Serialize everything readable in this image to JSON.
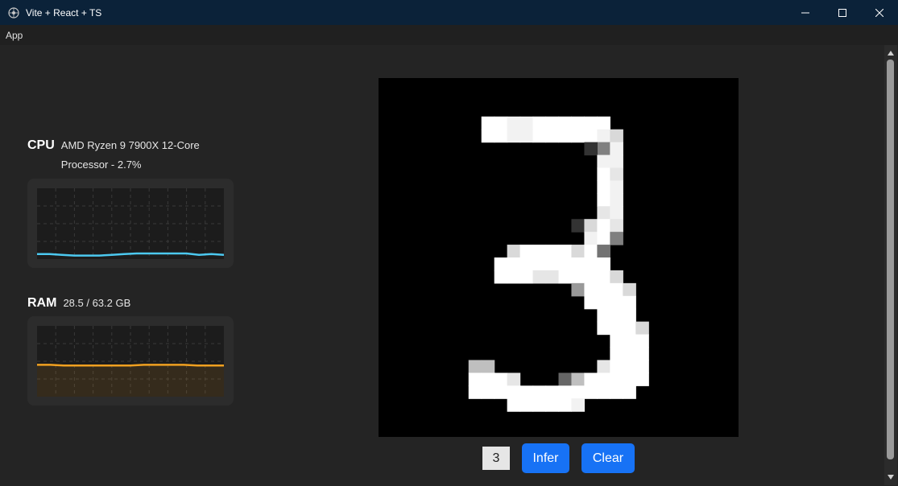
{
  "window": {
    "title": "Vite + React + TS"
  },
  "menu": {
    "items": [
      "App"
    ]
  },
  "cpu": {
    "label": "CPU",
    "name": "AMD Ryzen 9 7900X 12-Core Processor",
    "usage_percent": 2.7,
    "detail": "AMD Ryzen 9 7900X 12-Core Processor - 2.7%",
    "history_percent": [
      7,
      7,
      6,
      5,
      5,
      5,
      6,
      7,
      8,
      8,
      8,
      8,
      8,
      6,
      7,
      6
    ],
    "color": "#4cc9f0"
  },
  "ram": {
    "label": "RAM",
    "used_gb": 28.5,
    "total_gb": 63.2,
    "detail": "28.5 / 63.2 GB",
    "history_percent": [
      45,
      45,
      44,
      44,
      44,
      44,
      44,
      44,
      45,
      45,
      45,
      45,
      44,
      44,
      44
    ],
    "color": "#f0a020"
  },
  "digit": {
    "grid_size": 28,
    "strokes": [
      [
        8,
        3,
        1.0
      ],
      [
        9,
        3,
        1.0
      ],
      [
        10,
        3,
        0.95
      ],
      [
        11,
        3,
        0.95
      ],
      [
        12,
        3,
        1.0
      ],
      [
        13,
        3,
        1.0
      ],
      [
        14,
        3,
        1.0
      ],
      [
        15,
        3,
        1.0
      ],
      [
        16,
        3,
        1.0
      ],
      [
        17,
        3,
        1.0
      ],
      [
        8,
        4,
        1.0
      ],
      [
        9,
        4,
        1.0
      ],
      [
        10,
        4,
        0.95
      ],
      [
        11,
        4,
        0.95
      ],
      [
        12,
        4,
        1.0
      ],
      [
        13,
        4,
        1.0
      ],
      [
        14,
        4,
        1.0
      ],
      [
        15,
        4,
        1.0
      ],
      [
        16,
        4,
        1.0
      ],
      [
        17,
        4,
        0.95
      ],
      [
        18,
        4,
        0.85
      ],
      [
        17,
        5,
        0.5
      ],
      [
        18,
        5,
        0.95
      ],
      [
        16,
        5,
        0.2
      ],
      [
        17,
        6,
        0.95
      ],
      [
        18,
        6,
        0.95
      ],
      [
        17,
        7,
        1.0
      ],
      [
        18,
        7,
        0.9
      ],
      [
        17,
        8,
        1.0
      ],
      [
        18,
        8,
        0.95
      ],
      [
        17,
        9,
        1.0
      ],
      [
        18,
        9,
        0.95
      ],
      [
        17,
        10,
        0.9
      ],
      [
        18,
        10,
        0.95
      ],
      [
        15,
        11,
        0.2
      ],
      [
        16,
        11,
        0.85
      ],
      [
        17,
        11,
        1.0
      ],
      [
        18,
        11,
        0.9
      ],
      [
        16,
        12,
        0.95
      ],
      [
        17,
        12,
        1.0
      ],
      [
        18,
        12,
        0.5
      ],
      [
        10,
        13,
        0.85
      ],
      [
        11,
        13,
        1.0
      ],
      [
        12,
        13,
        1.0
      ],
      [
        13,
        13,
        1.0
      ],
      [
        14,
        13,
        1.0
      ],
      [
        15,
        13,
        0.85
      ],
      [
        16,
        13,
        1.0
      ],
      [
        17,
        13,
        0.45
      ],
      [
        9,
        14,
        1.0
      ],
      [
        10,
        14,
        1.0
      ],
      [
        11,
        14,
        1.0
      ],
      [
        12,
        14,
        1.0
      ],
      [
        13,
        14,
        1.0
      ],
      [
        14,
        14,
        1.0
      ],
      [
        15,
        14,
        1.0
      ],
      [
        16,
        14,
        1.0
      ],
      [
        17,
        14,
        1.0
      ],
      [
        9,
        15,
        1.0
      ],
      [
        10,
        15,
        1.0
      ],
      [
        11,
        15,
        1.0
      ],
      [
        12,
        15,
        0.9
      ],
      [
        13,
        15,
        0.9
      ],
      [
        14,
        15,
        1.0
      ],
      [
        15,
        15,
        1.0
      ],
      [
        16,
        15,
        1.0
      ],
      [
        17,
        15,
        1.0
      ],
      [
        18,
        15,
        0.85
      ],
      [
        15,
        16,
        0.6
      ],
      [
        16,
        16,
        1.0
      ],
      [
        17,
        16,
        1.0
      ],
      [
        18,
        16,
        1.0
      ],
      [
        19,
        16,
        0.85
      ],
      [
        16,
        17,
        1.0
      ],
      [
        17,
        17,
        1.0
      ],
      [
        18,
        17,
        1.0
      ],
      [
        19,
        17,
        1.0
      ],
      [
        17,
        18,
        1.0
      ],
      [
        18,
        18,
        1.0
      ],
      [
        19,
        18,
        1.0
      ],
      [
        17,
        19,
        1.0
      ],
      [
        18,
        19,
        1.0
      ],
      [
        19,
        19,
        1.0
      ],
      [
        20,
        19,
        0.85
      ],
      [
        18,
        20,
        1.0
      ],
      [
        19,
        20,
        1.0
      ],
      [
        20,
        20,
        1.0
      ],
      [
        18,
        21,
        1.0
      ],
      [
        19,
        21,
        1.0
      ],
      [
        20,
        21,
        1.0
      ],
      [
        7,
        22,
        0.75
      ],
      [
        8,
        22,
        0.75
      ],
      [
        17,
        22,
        0.9
      ],
      [
        18,
        22,
        1.0
      ],
      [
        19,
        22,
        1.0
      ],
      [
        20,
        22,
        1.0
      ],
      [
        7,
        23,
        1.0
      ],
      [
        8,
        23,
        1.0
      ],
      [
        9,
        23,
        1.0
      ],
      [
        10,
        23,
        0.9
      ],
      [
        14,
        23,
        0.4
      ],
      [
        15,
        23,
        0.75
      ],
      [
        16,
        23,
        1.0
      ],
      [
        17,
        23,
        1.0
      ],
      [
        18,
        23,
        1.0
      ],
      [
        19,
        23,
        1.0
      ],
      [
        20,
        23,
        1.0
      ],
      [
        7,
        24,
        1.0
      ],
      [
        8,
        24,
        1.0
      ],
      [
        9,
        24,
        1.0
      ],
      [
        10,
        24,
        1.0
      ],
      [
        11,
        24,
        1.0
      ],
      [
        12,
        24,
        1.0
      ],
      [
        13,
        24,
        1.0
      ],
      [
        14,
        24,
        1.0
      ],
      [
        15,
        24,
        1.0
      ],
      [
        16,
        24,
        1.0
      ],
      [
        17,
        24,
        1.0
      ],
      [
        18,
        24,
        1.0
      ],
      [
        19,
        24,
        1.0
      ],
      [
        10,
        25,
        1.0
      ],
      [
        11,
        25,
        1.0
      ],
      [
        12,
        25,
        1.0
      ],
      [
        13,
        25,
        1.0
      ],
      [
        14,
        25,
        1.0
      ],
      [
        15,
        25,
        0.95
      ]
    ]
  },
  "controls": {
    "prediction": "3",
    "infer_label": "Infer",
    "clear_label": "Clear"
  }
}
